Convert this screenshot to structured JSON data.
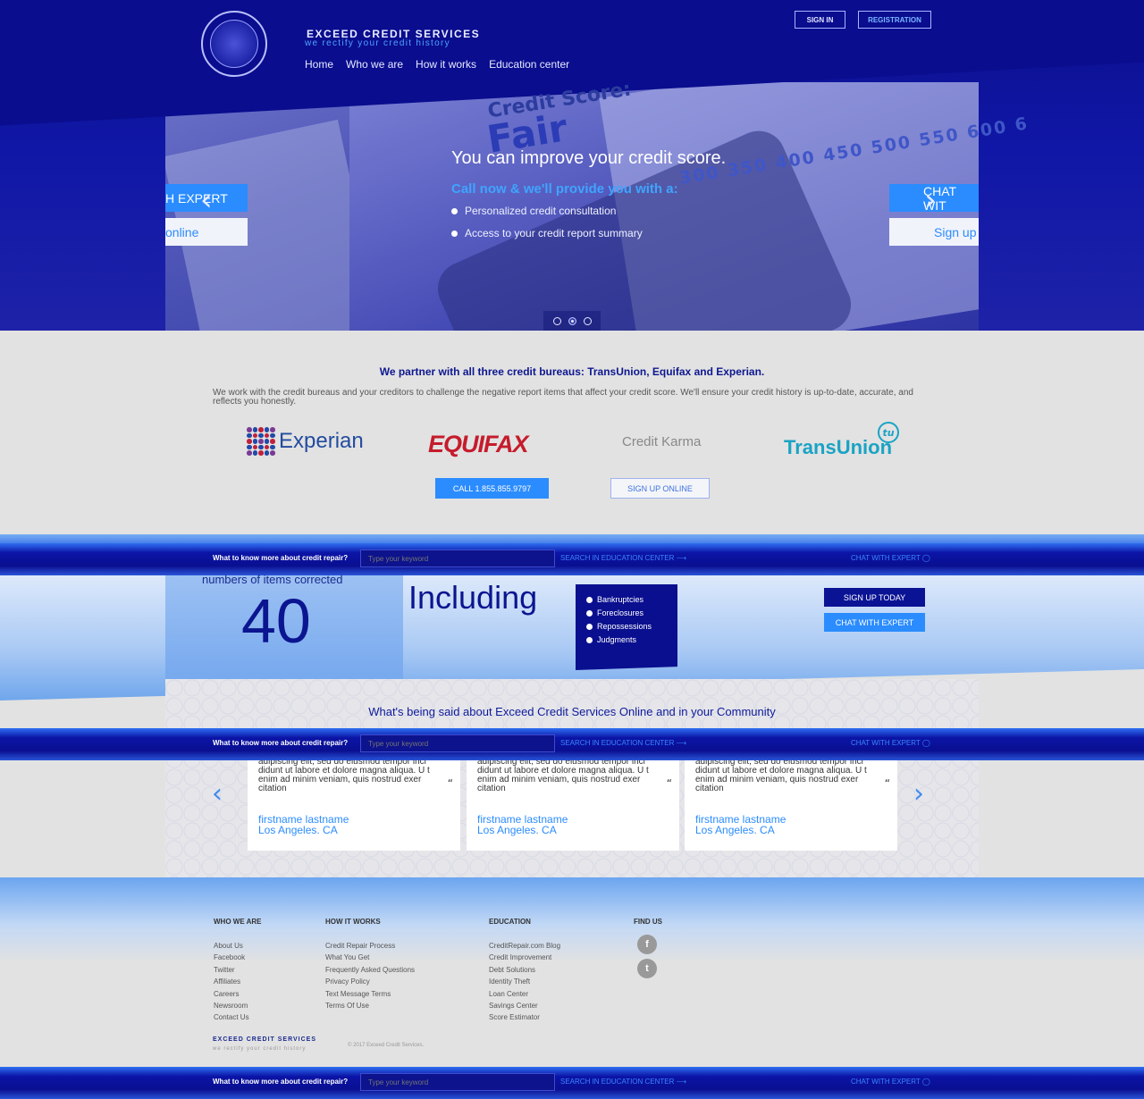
{
  "brand": {
    "name": "EXCEED CREDIT SERVICES",
    "tagline": "we rectify your credit history"
  },
  "nav": [
    "Home",
    "Who we are",
    "How it works",
    "Education center"
  ],
  "auth": {
    "signin": "SIGN IN",
    "registration": "REGISTRATION"
  },
  "hero": {
    "headline": "You can improve your credit score.",
    "sub": "Call now & we'll provide you with a:",
    "bullets": [
      "Personalized credit consultation",
      "Access to your credit report summary"
    ],
    "image_text": {
      "credit_score": "Credit Score:",
      "rating": "Fair",
      "scale": "300 350 400 450 500 550 600 6"
    },
    "left_btn_top": "H EXPERT",
    "left_btn_bottom": "online",
    "right_btn_top": "CHAT WIT",
    "right_btn_bottom": "Sign up",
    "slides": 3,
    "active_slide": 2
  },
  "partners": {
    "title": "We partner with all three credit bureaus: TransUnion, Equifax and Experian.",
    "text": "We work with the credit bureaus and your creditors to challenge the negative report items that affect your credit score. We'll ensure your credit history is up-to-date, accurate, and reflects you honestly.",
    "logos": {
      "experian": "Experian",
      "equifax": "EQUIFAX",
      "creditkarma": "Credit Karma",
      "transunion": "TransUnion",
      "tu": "tu"
    },
    "call_btn": "CALL 1.855.855.9797",
    "signup_btn": "SIGN UP ONLINE"
  },
  "searchbar": {
    "label": "What to know more about credit repair?",
    "placeholder": "Type your keyword",
    "search_link": "SEARCH IN EDUCATION CENTER",
    "chat_link": "CHAT WITH EXPERT"
  },
  "stats": {
    "label": "numbers of items corrected",
    "number": "40",
    "including": "Including",
    "items": [
      "Bankruptcies",
      "Foreclosures",
      "Repossessions",
      "Judgments"
    ],
    "signup_btn": "SIGN UP TODAY",
    "chat_btn": "CHAT WITH EXPERT"
  },
  "testimonials": {
    "title": "What's being said about Exceed Credit Services Online and in your Community",
    "cards": [
      {
        "text": "adipiscing elit, sed do eiusmod tempor inci didunt ut labore et dolore magna aliqua. U t enim ad minim veniam, quis nostrud exer citation",
        "name": "firstname lastname",
        "location": "Los Angeles. CA"
      },
      {
        "text": "adipiscing elit, sed do eiusmod tempor inci didunt ut labore et dolore magna aliqua. U t enim ad minim veniam, quis nostrud exer citation",
        "name": "firstname lastname",
        "location": "Los Angeles. CA"
      },
      {
        "text": "adipiscing elit, sed do eiusmod tempor inci didunt ut labore et dolore magna aliqua. U t enim ad minim veniam, quis nostrud exer citation",
        "name": "firstname lastname",
        "location": "Los Angeles. CA"
      }
    ]
  },
  "footer": {
    "who": {
      "title": "WHO WE ARE",
      "links": [
        "About Us",
        "Facebook",
        "Twitter",
        "Affiliates",
        "Careers",
        "Newsroom",
        "Contact Us"
      ]
    },
    "how": {
      "title": "HOW IT WORKS",
      "links": [
        "Credit Repair Process",
        "What You Get",
        "Frequently Asked Questions",
        "Privacy Policy",
        "Text Message Terms",
        "Terms Of Use"
      ]
    },
    "edu": {
      "title": "EDUCATION",
      "links": [
        "CreditRepair.com Blog",
        "Credit Improvement",
        "Debt Solutions",
        "Identity Theft",
        "Loan Center",
        "Savings Center",
        "Score Estimator"
      ]
    },
    "find": {
      "title": "FIND US",
      "facebook": "f",
      "twitter": "t"
    },
    "brand": "EXCEED CREDIT SERVICES",
    "tagline": "we rectify your credit history",
    "copyright": "© 2017 Exceed Credit Services."
  },
  "colors": {
    "primary": "#0a0f90",
    "accent": "#2b8cff",
    "background": "#e2e2e2"
  }
}
